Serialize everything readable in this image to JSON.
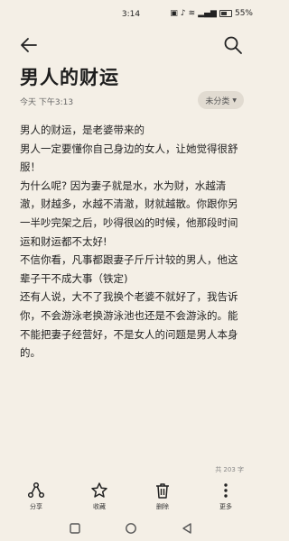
{
  "status_bar": {
    "time": "3:14",
    "battery": "55%"
  },
  "note": {
    "title": "男人的财运",
    "meta": "今天 下午3:13",
    "category": "未分类",
    "paragraphs": [
      "男人的财运，是老婆带来的",
      "男人一定要懂你自己身边的女人，让她觉得很舒服！",
      "为什么呢? 因为妻子就是水，水为财，水越清澈，财越多，水越不清澈，财就越散。你跟你另一半吵完架之后，吵得很凶的时候，他那段时间运和财运都不太好!",
      "不信你看，凡事都跟妻子斤斤计较的男人，他这辈子干不成大事（铁定)",
      "还有人说，大不了我换个老婆不就好了，我告诉你，不会游泳老换游泳池也还是不会游泳的。能不能把妻子经营好，不是女人的问题是男人本身的。"
    ],
    "word_count": "共 203 字"
  },
  "toolbar": {
    "share": "分享",
    "favorite": "收藏",
    "delete": "删除",
    "more": "更多"
  },
  "icons": {
    "back": "arrow-left-icon",
    "search": "search-icon",
    "share": "share-icon",
    "favorite": "star-icon",
    "delete": "trash-icon",
    "more": "more-vertical-icon"
  }
}
